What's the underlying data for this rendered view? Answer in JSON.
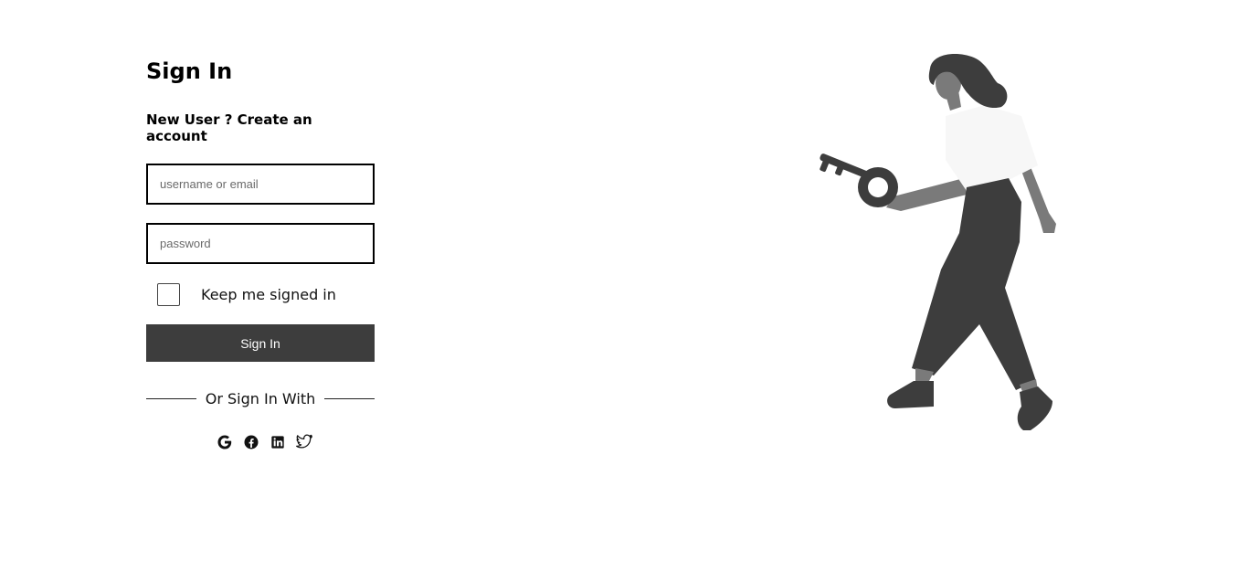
{
  "form": {
    "title": "Sign In",
    "new_user_text": "New User ? Create an account",
    "username": {
      "placeholder": "username or email",
      "value": ""
    },
    "password": {
      "placeholder": "password",
      "value": ""
    },
    "remember_label": "Keep me signed in",
    "remember_checked": false,
    "submit_label": "Sign In",
    "divider_text": "Or Sign In With"
  },
  "social_icons": [
    "google-icon",
    "facebook-icon",
    "linkedin-icon",
    "twitter-icon"
  ],
  "illustration": {
    "icon": "woman-holding-key-illustration",
    "colors": {
      "dark": "#3d3d3d",
      "skin": "#7a7a7a",
      "shirt": "#f7f7f7"
    }
  },
  "colors": {
    "button_bg": "#3d3d3d",
    "button_text": "#ffffff",
    "border": "#000000"
  }
}
